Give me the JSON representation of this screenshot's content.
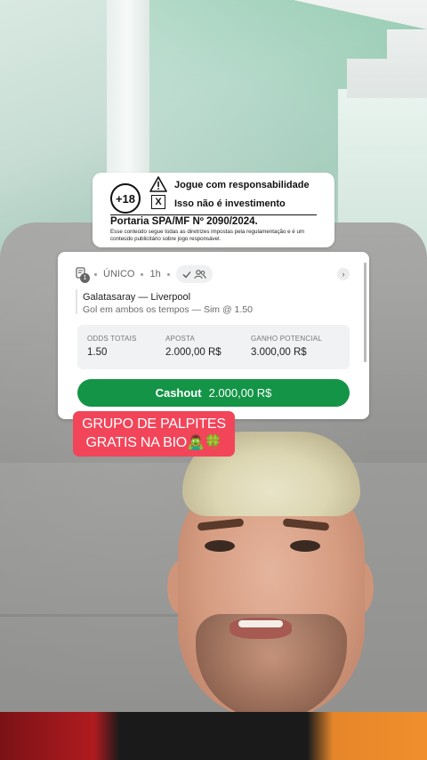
{
  "notice": {
    "age_badge": "+18",
    "line1": "Jogue com responsabilidade",
    "line2": "Isso não é investimento",
    "x_mark": "X",
    "portaria": "Portaria SPA/MF Nº 2090/2024.",
    "fine_print": "Esse conteúdo segue todas as diretrizes impostas pela regulamentação e é um conteúdo publicitário sobre jogo responsável."
  },
  "bet_card": {
    "ticket_count": "1",
    "bet_type": "ÚNICO",
    "time_ago": "1h",
    "chevron": "›",
    "match": "Galatasaray — Liverpool",
    "selection": "Gol em ambos os tempos — Sim @ 1.50",
    "stats": {
      "odds_label": "ODDS TOTAIS",
      "odds_value": "1.50",
      "stake_label": "APOSTA",
      "stake_value": "2.000,00 R$",
      "payout_label": "GANHO POTENCIAL",
      "payout_value": "3.000,00 R$"
    },
    "cashout_label": "Cashout",
    "cashout_amount": "2.000,00 R$",
    "accent_color": "#149447"
  },
  "caption": {
    "line1": "GRUPO DE PALPITES",
    "line2": "GRATIS NA BIO🧟‍♂️🍀",
    "background_color": "#f2455a"
  }
}
